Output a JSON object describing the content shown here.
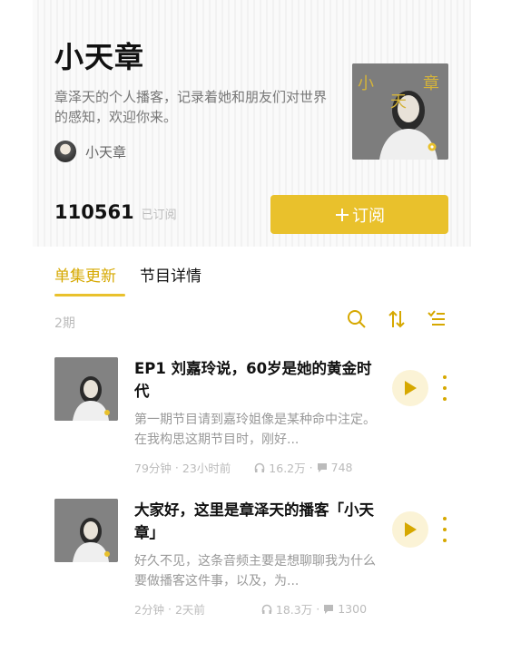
{
  "podcast": {
    "title": "小天章",
    "description": "章泽天的个人播客，记录着她和朋友们对世界的感知，欢迎你来。",
    "author_name": "小天章",
    "cover_text": [
      "小",
      "天",
      "章"
    ]
  },
  "subscription": {
    "count": "110561",
    "count_label": "已订阅",
    "button_label": "订阅",
    "button_icon": "plus-icon"
  },
  "tabs": [
    {
      "label": "单集更新",
      "active": true
    },
    {
      "label": "节目详情",
      "active": false
    }
  ],
  "list": {
    "count_label": "2期",
    "tools": [
      "search-icon",
      "sort-icon",
      "filter-list-icon"
    ]
  },
  "episodes": [
    {
      "title": "EP1 刘嘉玲说，60岁是她的黄金时代",
      "description": "第一期节目请到嘉玲姐像是某种命中注定。 在我构思这期节目时，刚好...",
      "duration": "79分钟",
      "time_ago": "23小时前",
      "plays": "16.2万",
      "comments": "748"
    },
    {
      "title": "大家好，这里是章泽天的播客「小天章」",
      "description": "好久不见，这条音频主要是想聊聊我为什么要做播客这件事，以及，为...",
      "duration": "2分钟",
      "time_ago": "2天前",
      "plays": "18.3万",
      "comments": "1300"
    }
  ],
  "colors": {
    "accent": "#e9c12c",
    "accent_text": "#d6a800"
  }
}
